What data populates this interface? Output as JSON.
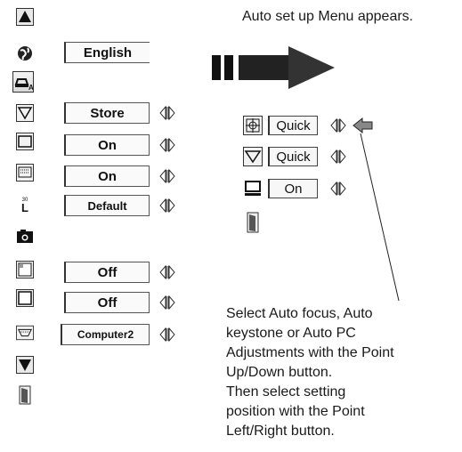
{
  "caption_top": "Auto set up Menu appears.",
  "instructions": [
    "Select Auto focus, Auto",
    "keystone or Auto PC",
    "Adjustments with the Point",
    "Up/Down button.",
    "Then select setting",
    "position with the Point",
    "Left/Right button."
  ],
  "left_menu": {
    "icons": [
      "up-arrow-icon",
      "globe-icon",
      "auto-setup-icon",
      "keystone-icon",
      "screen-icon",
      "display-icon",
      "logo-icon",
      "capture-icon",
      "blank-screen-icon",
      "frame-icon",
      "input-icon",
      "down-arrow-icon",
      "exit-door-icon"
    ],
    "language_value": "English",
    "keystone_value": "Store",
    "screen_value": "On",
    "display_value": "On",
    "logo_value": "Default",
    "blank_value": "Off",
    "frame_value": "Off",
    "input_value": "Computer2"
  },
  "auto_setup_menu": {
    "focus_value": "Quick",
    "keystone_value": "Quick",
    "pc_adjust_value": "On"
  },
  "colors": {
    "ink": "#111111",
    "background": "#ffffff"
  }
}
